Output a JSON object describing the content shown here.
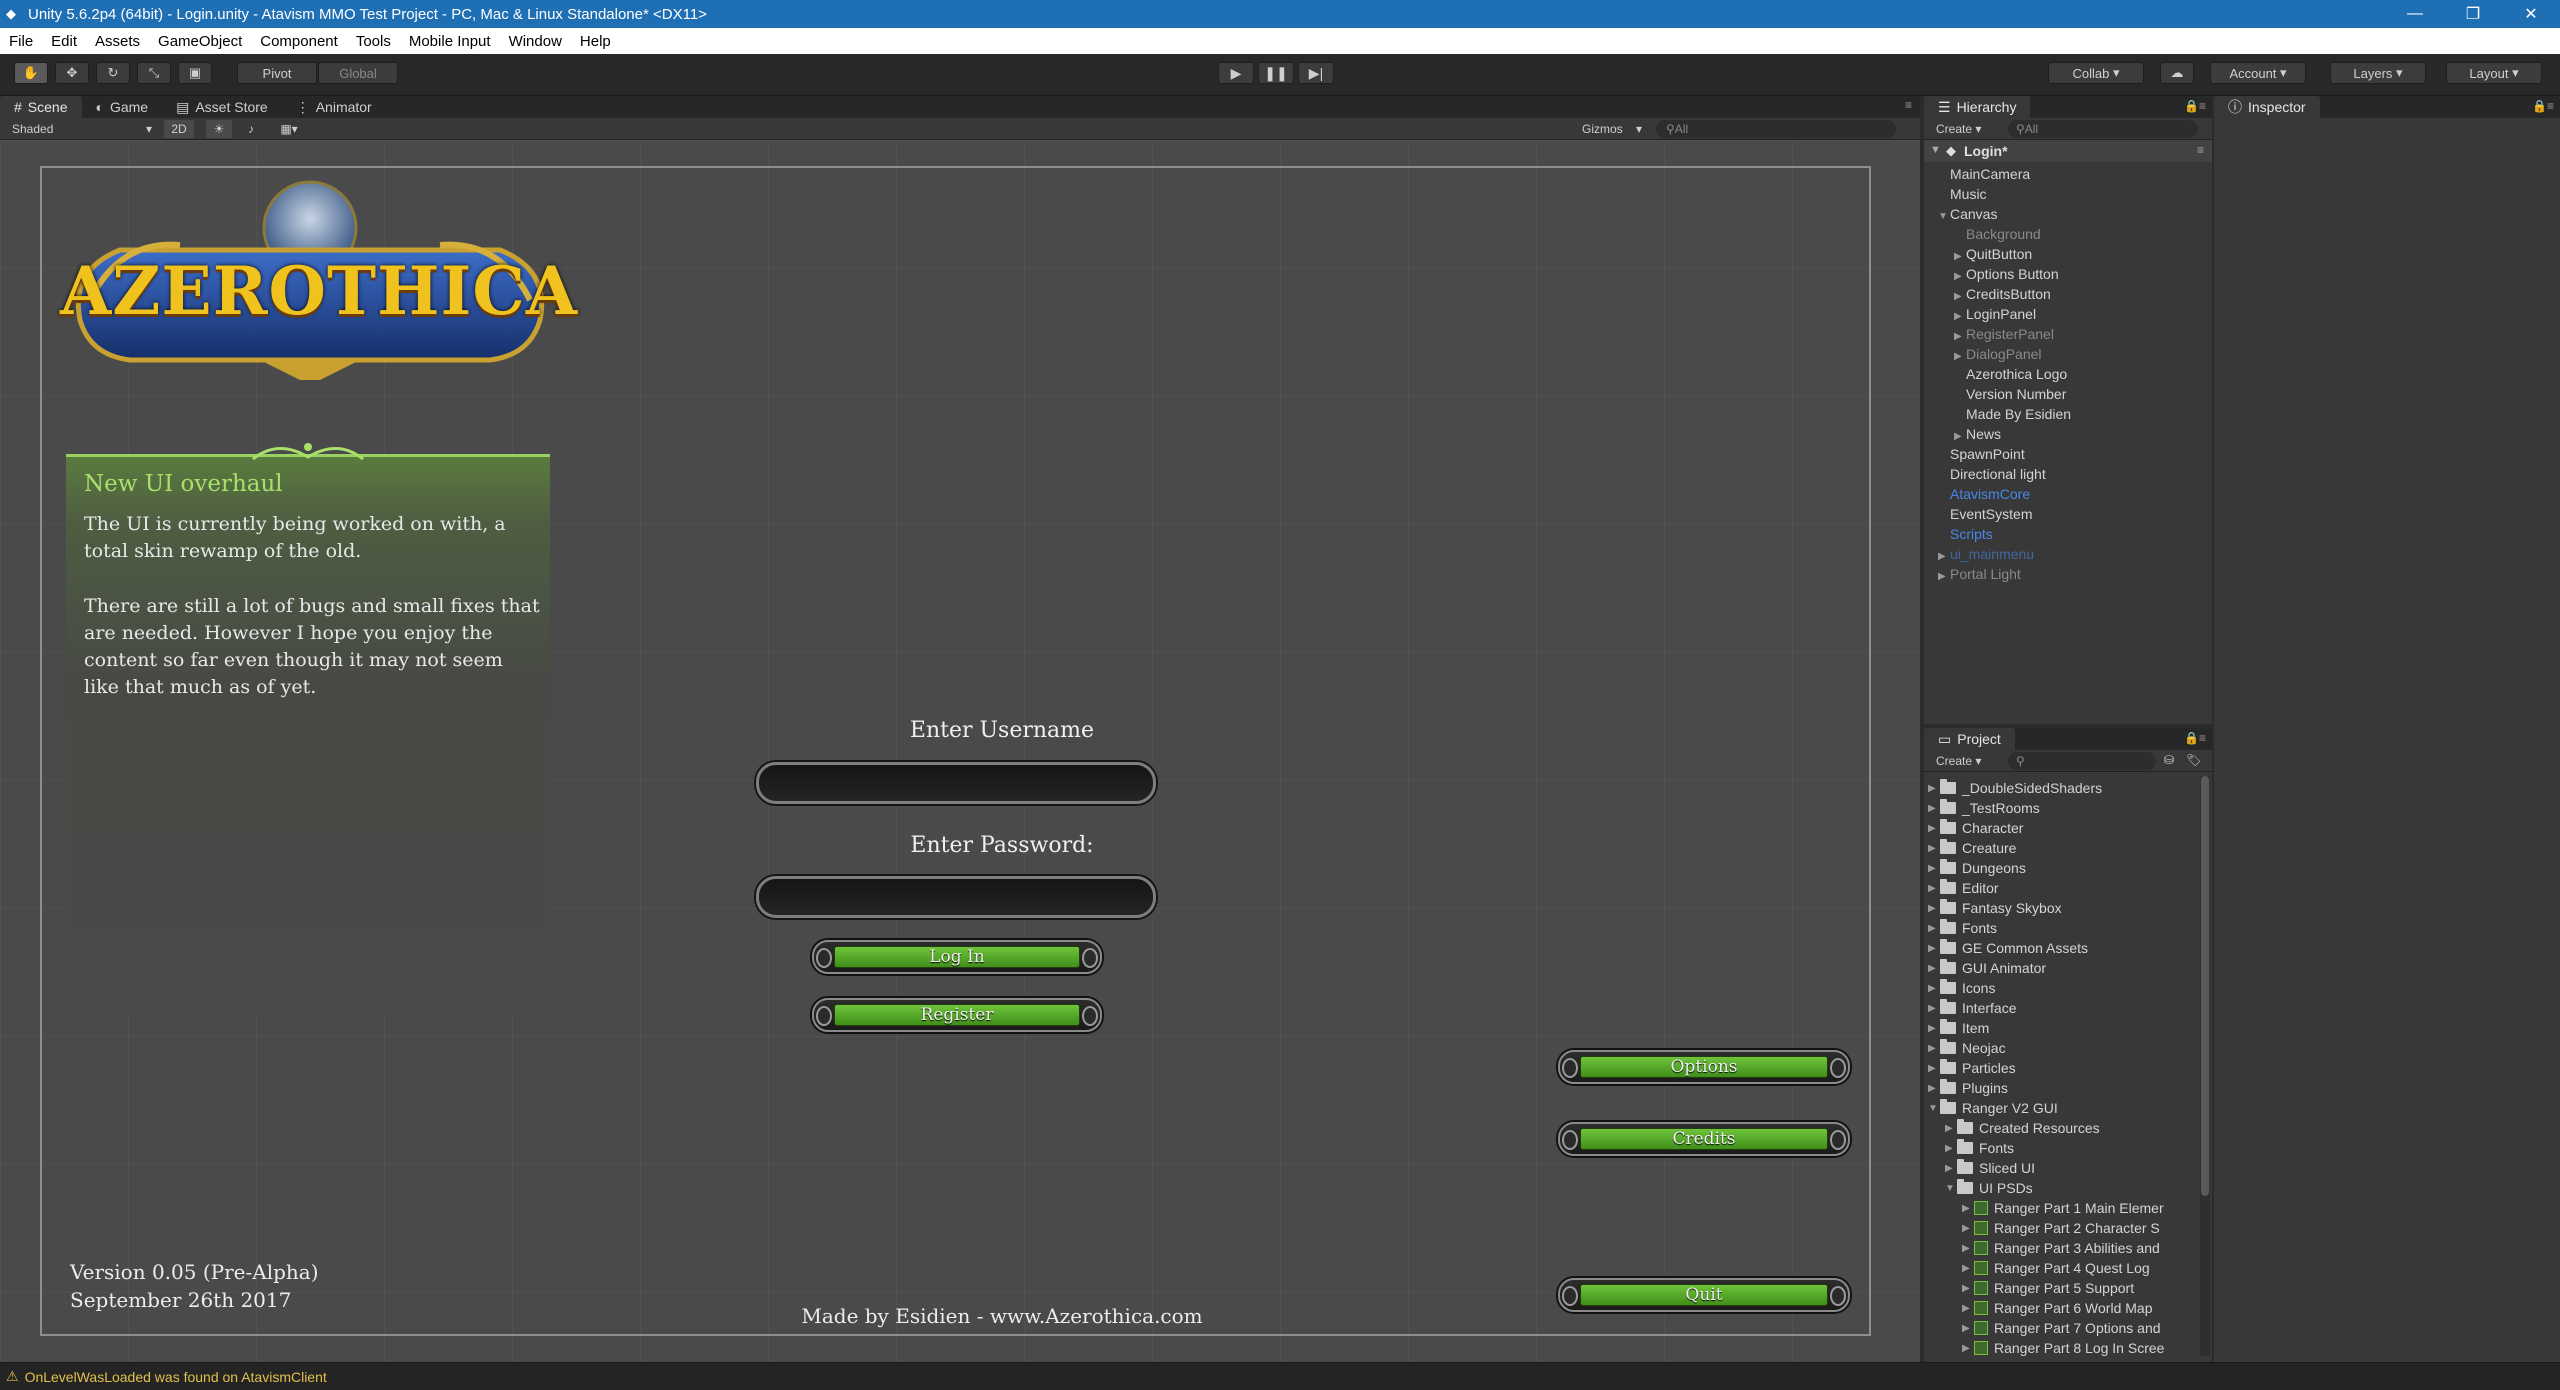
{
  "window": {
    "title": "Unity 5.6.2p4 (64bit) - Login.unity - Atavism MMO Test Project - PC, Mac & Linux Standalone* <DX11>"
  },
  "menu": [
    "File",
    "Edit",
    "Assets",
    "GameObject",
    "Component",
    "Tools",
    "Mobile Input",
    "Window",
    "Help"
  ],
  "toolbar": {
    "pivot": "Pivot",
    "global": "Global",
    "collab": "Collab",
    "account": "Account",
    "layers": "Layers",
    "layout": "Layout"
  },
  "scene_tabs": [
    "Scene",
    "Game",
    "Asset Store",
    "Animator"
  ],
  "scene_bar": {
    "shaded": "Shaded",
    "mode2d": "2D",
    "gizmos": "Gizmos",
    "search_placeholder": "All"
  },
  "game_ui": {
    "logo": "AZEROTHICA",
    "news_title": "New UI overhaul",
    "news_p1": "The UI is currently being worked on with, a total skin rewamp of the old.",
    "news_p2": "There are still a lot of bugs and small fixes that are needed. However I hope you enjoy the content so far even though it may not seem like that much as of yet.",
    "username_label": "Enter Username",
    "password_label": "Enter Password:",
    "login": "Log In",
    "register": "Register",
    "options": "Options",
    "credits": "Credits",
    "quit": "Quit",
    "version": "Version 0.05 (Pre-Alpha)",
    "date": "September 26th 2017",
    "made_by": "Made by Esidien - www.Azerothica.com"
  },
  "hierarchy": {
    "tab": "Hierarchy",
    "create": "Create",
    "search_placeholder": "All",
    "scene": "Login*",
    "items": [
      {
        "label": "MainCamera",
        "depth": 1,
        "arrow": "",
        "style": "normal"
      },
      {
        "label": "Music",
        "depth": 1,
        "arrow": "",
        "style": "normal"
      },
      {
        "label": "Canvas",
        "depth": 1,
        "arrow": "open",
        "style": "normal"
      },
      {
        "label": "Background",
        "depth": 2,
        "arrow": "",
        "style": "dim"
      },
      {
        "label": "QuitButton",
        "depth": 2,
        "arrow": "closed",
        "style": "normal"
      },
      {
        "label": "Options Button",
        "depth": 2,
        "arrow": "closed",
        "style": "normal"
      },
      {
        "label": "CreditsButton",
        "depth": 2,
        "arrow": "closed",
        "style": "normal"
      },
      {
        "label": "LoginPanel",
        "depth": 2,
        "arrow": "closed",
        "style": "normal"
      },
      {
        "label": "RegisterPanel",
        "depth": 2,
        "arrow": "closed",
        "style": "dim"
      },
      {
        "label": "DialogPanel",
        "depth": 2,
        "arrow": "closed",
        "style": "dim"
      },
      {
        "label": "Azerothica Logo",
        "depth": 2,
        "arrow": "",
        "style": "normal"
      },
      {
        "label": "Version Number",
        "depth": 2,
        "arrow": "",
        "style": "normal"
      },
      {
        "label": "Made By Esidien",
        "depth": 2,
        "arrow": "",
        "style": "normal"
      },
      {
        "label": "News",
        "depth": 2,
        "arrow": "closed",
        "style": "normal"
      },
      {
        "label": "SpawnPoint",
        "depth": 1,
        "arrow": "",
        "style": "normal"
      },
      {
        "label": "Directional light",
        "depth": 1,
        "arrow": "",
        "style": "normal"
      },
      {
        "label": "AtavismCore",
        "depth": 1,
        "arrow": "",
        "style": "blue"
      },
      {
        "label": "EventSystem",
        "depth": 1,
        "arrow": "",
        "style": "normal"
      },
      {
        "label": "Scripts",
        "depth": 1,
        "arrow": "",
        "style": "blue"
      },
      {
        "label": "ui_mainmenu",
        "depth": 1,
        "arrow": "closed",
        "style": "bluedim"
      },
      {
        "label": "Portal Light",
        "depth": 1,
        "arrow": "closed",
        "style": "dim"
      }
    ]
  },
  "inspector": {
    "tab": "Inspector"
  },
  "project": {
    "tab": "Project",
    "create": "Create",
    "items": [
      {
        "label": "_DoubleSidedShaders",
        "depth": 0,
        "arrow": "closed",
        "kind": "folder"
      },
      {
        "label": "_TestRooms",
        "depth": 0,
        "arrow": "closed",
        "kind": "folder"
      },
      {
        "label": "Character",
        "depth": 0,
        "arrow": "closed",
        "kind": "folder"
      },
      {
        "label": "Creature",
        "depth": 0,
        "arrow": "closed",
        "kind": "folder"
      },
      {
        "label": "Dungeons",
        "depth": 0,
        "arrow": "closed",
        "kind": "folder"
      },
      {
        "label": "Editor",
        "depth": 0,
        "arrow": "closed",
        "kind": "folder"
      },
      {
        "label": "Fantasy Skybox",
        "depth": 0,
        "arrow": "closed",
        "kind": "folder"
      },
      {
        "label": "Fonts",
        "depth": 0,
        "arrow": "closed",
        "kind": "folder"
      },
      {
        "label": "GE Common Assets",
        "depth": 0,
        "arrow": "closed",
        "kind": "folder"
      },
      {
        "label": "GUI Animator",
        "depth": 0,
        "arrow": "closed",
        "kind": "folder"
      },
      {
        "label": "Icons",
        "depth": 0,
        "arrow": "closed",
        "kind": "folder"
      },
      {
        "label": "Interface",
        "depth": 0,
        "arrow": "closed",
        "kind": "folder"
      },
      {
        "label": "Item",
        "depth": 0,
        "arrow": "closed",
        "kind": "folder"
      },
      {
        "label": "Neojac",
        "depth": 0,
        "arrow": "closed",
        "kind": "folder"
      },
      {
        "label": "Particles",
        "depth": 0,
        "arrow": "closed",
        "kind": "folder"
      },
      {
        "label": "Plugins",
        "depth": 0,
        "arrow": "closed",
        "kind": "folder"
      },
      {
        "label": "Ranger V2 GUI",
        "depth": 0,
        "arrow": "open",
        "kind": "folder"
      },
      {
        "label": "Created Resources",
        "depth": 1,
        "arrow": "closed",
        "kind": "folder"
      },
      {
        "label": "Fonts",
        "depth": 1,
        "arrow": "closed",
        "kind": "folder"
      },
      {
        "label": "Sliced UI",
        "depth": 1,
        "arrow": "closed",
        "kind": "folder"
      },
      {
        "label": "UI PSDs",
        "depth": 1,
        "arrow": "open",
        "kind": "folder"
      },
      {
        "label": "Ranger Part 1 Main Elemer",
        "depth": 2,
        "arrow": "closed",
        "kind": "psd"
      },
      {
        "label": "Ranger Part 2 Character S",
        "depth": 2,
        "arrow": "closed",
        "kind": "psd"
      },
      {
        "label": "Ranger Part 3 Abilities and",
        "depth": 2,
        "arrow": "closed",
        "kind": "psd"
      },
      {
        "label": "Ranger Part 4 Quest Log",
        "depth": 2,
        "arrow": "closed",
        "kind": "psd"
      },
      {
        "label": "Ranger Part 5 Support",
        "depth": 2,
        "arrow": "closed",
        "kind": "psd"
      },
      {
        "label": "Ranger Part 6 World Map",
        "depth": 2,
        "arrow": "closed",
        "kind": "psd"
      },
      {
        "label": "Ranger Part 7 Options and",
        "depth": 2,
        "arrow": "closed",
        "kind": "psd"
      },
      {
        "label": "Ranger Part 8 Log In Scree",
        "depth": 2,
        "arrow": "closed",
        "kind": "psd"
      }
    ]
  },
  "status": {
    "message": "OnLevelWasLoaded was found on AtavismClient"
  }
}
